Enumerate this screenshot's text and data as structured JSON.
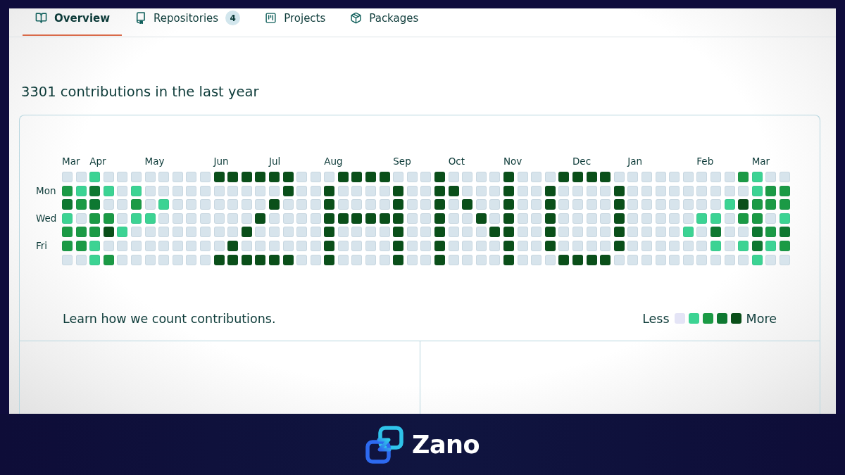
{
  "tabs": [
    {
      "kind": "overview",
      "label": "Overview",
      "selected": true
    },
    {
      "kind": "repositories",
      "label": "Repositories",
      "count": "4",
      "selected": false
    },
    {
      "kind": "projects",
      "label": "Projects",
      "selected": false
    },
    {
      "kind": "packages",
      "label": "Packages",
      "selected": false
    }
  ],
  "contributions": {
    "heading": "3301 contributions in the last year",
    "day_labels": [
      "Mon",
      "Wed",
      "Fri"
    ],
    "weeks": [
      {
        "month": "Mar",
        "days": [
          {
            "color": "#d7e4ec"
          },
          {
            "color": "#1b9a45"
          },
          {
            "color": "#0e7831"
          },
          {
            "color": "#3cd393"
          },
          {
            "color": "#1b9a45"
          },
          {
            "color": "#1b9a45"
          },
          {
            "color": "#d7e4ec"
          }
        ]
      },
      {
        "days": [
          {
            "color": "#d7e4ec"
          },
          {
            "color": "#3cd393"
          },
          {
            "color": "#1b9a45"
          },
          {
            "color": "#d7e4ec"
          },
          {
            "color": "#1b9a45"
          },
          {
            "color": "#1b9a45"
          },
          {
            "color": "#d7e4ec"
          }
        ]
      },
      {
        "month": "Apr",
        "days": [
          {
            "color": "#3cd393"
          },
          {
            "color": "#0e7831"
          },
          {
            "color": "#0e7831"
          },
          {
            "color": "#1b9a45"
          },
          {
            "color": "#1b9a45"
          },
          {
            "color": "#3cd393"
          },
          {
            "color": "#3cd393"
          }
        ]
      },
      {
        "days": [
          {
            "color": "#d7e4ec"
          },
          {
            "color": "#3cd393"
          },
          {
            "color": "#d7e4ec"
          },
          {
            "color": "#1b9a45"
          },
          {
            "color": "#0a4f19"
          },
          {
            "color": "#d7e4ec"
          },
          {
            "color": "#1b9a45"
          }
        ]
      },
      {
        "days": [
          {
            "color": "#d7e4ec"
          },
          {
            "color": "#d7e4ec"
          },
          {
            "color": "#d7e4ec"
          },
          {
            "color": "#d7e4ec"
          },
          {
            "color": "#3cd393"
          },
          {
            "color": "#d7e4ec"
          },
          {
            "color": "#d7e4ec"
          }
        ]
      },
      {
        "days": [
          {
            "color": "#d7e4ec"
          },
          {
            "color": "#3cd393"
          },
          {
            "color": "#1b9a45"
          },
          {
            "color": "#3cd393"
          },
          {
            "color": "#d7e4ec"
          },
          {
            "color": "#d7e4ec"
          },
          {
            "color": "#d7e4ec"
          }
        ]
      },
      {
        "month": "May",
        "days": [
          {
            "color": "#d7e4ec"
          },
          {
            "color": "#d7e4ec"
          },
          {
            "color": "#d7e4ec"
          },
          {
            "color": "#3cd393"
          },
          {
            "color": "#d7e4ec"
          },
          {
            "color": "#d7e4ec"
          },
          {
            "color": "#d7e4ec"
          }
        ]
      },
      {
        "days": [
          {
            "color": "#d7e4ec"
          },
          {
            "color": "#d7e4ec"
          },
          {
            "color": "#3cd393"
          },
          {
            "color": "#d7e4ec"
          },
          {
            "color": "#d7e4ec"
          },
          {
            "color": "#d7e4ec"
          },
          {
            "color": "#d7e4ec"
          }
        ]
      },
      {
        "days": [
          {
            "color": "#d7e4ec"
          },
          {
            "color": "#d7e4ec"
          },
          {
            "color": "#d7e4ec"
          },
          {
            "color": "#d7e4ec"
          },
          {
            "color": "#d7e4ec"
          },
          {
            "color": "#d7e4ec"
          },
          {
            "color": "#d7e4ec"
          }
        ]
      },
      {
        "days": [
          {
            "color": "#d7e4ec"
          },
          {
            "color": "#d7e4ec"
          },
          {
            "color": "#d7e4ec"
          },
          {
            "color": "#d7e4ec"
          },
          {
            "color": "#d7e4ec"
          },
          {
            "color": "#d7e4ec"
          },
          {
            "color": "#d7e4ec"
          }
        ]
      },
      {
        "days": [
          {
            "color": "#d7e4ec"
          },
          {
            "color": "#d7e4ec"
          },
          {
            "color": "#d7e4ec"
          },
          {
            "color": "#d7e4ec"
          },
          {
            "color": "#d7e4ec"
          },
          {
            "color": "#d7e4ec"
          },
          {
            "color": "#d7e4ec"
          }
        ]
      },
      {
        "month": "Jun",
        "days": [
          {
            "color": "#0a4f19"
          },
          {
            "color": "#d7e4ec"
          },
          {
            "color": "#d7e4ec"
          },
          {
            "color": "#d7e4ec"
          },
          {
            "color": "#d7e4ec"
          },
          {
            "color": "#d7e4ec"
          },
          {
            "color": "#0a4f19"
          }
        ]
      },
      {
        "days": [
          {
            "color": "#0a4f19"
          },
          {
            "color": "#d7e4ec"
          },
          {
            "color": "#d7e4ec"
          },
          {
            "color": "#d7e4ec"
          },
          {
            "color": "#d7e4ec"
          },
          {
            "color": "#0a4f19"
          },
          {
            "color": "#0a4f19"
          }
        ]
      },
      {
        "days": [
          {
            "color": "#0a4f19"
          },
          {
            "color": "#d7e4ec"
          },
          {
            "color": "#d7e4ec"
          },
          {
            "color": "#d7e4ec"
          },
          {
            "color": "#0a4f19"
          },
          {
            "color": "#d7e4ec"
          },
          {
            "color": "#0a4f19"
          }
        ]
      },
      {
        "days": [
          {
            "color": "#0a4f19"
          },
          {
            "color": "#d7e4ec"
          },
          {
            "color": "#d7e4ec"
          },
          {
            "color": "#0a4f19"
          },
          {
            "color": "#d7e4ec"
          },
          {
            "color": "#d7e4ec"
          },
          {
            "color": "#0a4f19"
          }
        ]
      },
      {
        "month": "Jul",
        "days": [
          {
            "color": "#0a4f19"
          },
          {
            "color": "#d7e4ec"
          },
          {
            "color": "#0a4f19"
          },
          {
            "color": "#d7e4ec"
          },
          {
            "color": "#d7e4ec"
          },
          {
            "color": "#d7e4ec"
          },
          {
            "color": "#0a4f19"
          }
        ]
      },
      {
        "days": [
          {
            "color": "#0a4f19"
          },
          {
            "color": "#0a4f19"
          },
          {
            "color": "#d7e4ec"
          },
          {
            "color": "#d7e4ec"
          },
          {
            "color": "#d7e4ec"
          },
          {
            "color": "#d7e4ec"
          },
          {
            "color": "#0a4f19"
          }
        ]
      },
      {
        "days": [
          {
            "color": "#d7e4ec"
          },
          {
            "color": "#d7e4ec"
          },
          {
            "color": "#d7e4ec"
          },
          {
            "color": "#d7e4ec"
          },
          {
            "color": "#d7e4ec"
          },
          {
            "color": "#d7e4ec"
          },
          {
            "color": "#d7e4ec"
          }
        ]
      },
      {
        "days": [
          {
            "color": "#d7e4ec"
          },
          {
            "color": "#d7e4ec"
          },
          {
            "color": "#d7e4ec"
          },
          {
            "color": "#d7e4ec"
          },
          {
            "color": "#d7e4ec"
          },
          {
            "color": "#d7e4ec"
          },
          {
            "color": "#d7e4ec"
          }
        ]
      },
      {
        "month": "Aug",
        "days": [
          {
            "color": "#d7e4ec"
          },
          {
            "color": "#0a4f19"
          },
          {
            "color": "#0a4f19"
          },
          {
            "color": "#0a4f19"
          },
          {
            "color": "#0a4f19"
          },
          {
            "color": "#0a4f19"
          },
          {
            "color": "#0a4f19"
          }
        ]
      },
      {
        "days": [
          {
            "color": "#0a4f19"
          },
          {
            "color": "#d7e4ec"
          },
          {
            "color": "#d7e4ec"
          },
          {
            "color": "#0a4f19"
          },
          {
            "color": "#d7e4ec"
          },
          {
            "color": "#d7e4ec"
          },
          {
            "color": "#d7e4ec"
          }
        ]
      },
      {
        "days": [
          {
            "color": "#0a4f19"
          },
          {
            "color": "#d7e4ec"
          },
          {
            "color": "#d7e4ec"
          },
          {
            "color": "#0a4f19"
          },
          {
            "color": "#d7e4ec"
          },
          {
            "color": "#d7e4ec"
          },
          {
            "color": "#d7e4ec"
          }
        ]
      },
      {
        "days": [
          {
            "color": "#0a4f19"
          },
          {
            "color": "#d7e4ec"
          },
          {
            "color": "#d7e4ec"
          },
          {
            "color": "#0a4f19"
          },
          {
            "color": "#d7e4ec"
          },
          {
            "color": "#d7e4ec"
          },
          {
            "color": "#d7e4ec"
          }
        ]
      },
      {
        "days": [
          {
            "color": "#0a4f19"
          },
          {
            "color": "#d7e4ec"
          },
          {
            "color": "#d7e4ec"
          },
          {
            "color": "#0a4f19"
          },
          {
            "color": "#d7e4ec"
          },
          {
            "color": "#d7e4ec"
          },
          {
            "color": "#d7e4ec"
          }
        ]
      },
      {
        "month": "Sep",
        "days": [
          {
            "color": "#d7e4ec"
          },
          {
            "color": "#0a4f19"
          },
          {
            "color": "#0a4f19"
          },
          {
            "color": "#0a4f19"
          },
          {
            "color": "#0a4f19"
          },
          {
            "color": "#0a4f19"
          },
          {
            "color": "#0a4f19"
          }
        ]
      },
      {
        "days": [
          {
            "color": "#d7e4ec"
          },
          {
            "color": "#d7e4ec"
          },
          {
            "color": "#d7e4ec"
          },
          {
            "color": "#d7e4ec"
          },
          {
            "color": "#d7e4ec"
          },
          {
            "color": "#d7e4ec"
          },
          {
            "color": "#d7e4ec"
          }
        ]
      },
      {
        "days": [
          {
            "color": "#d7e4ec"
          },
          {
            "color": "#d7e4ec"
          },
          {
            "color": "#d7e4ec"
          },
          {
            "color": "#d7e4ec"
          },
          {
            "color": "#d7e4ec"
          },
          {
            "color": "#d7e4ec"
          },
          {
            "color": "#d7e4ec"
          }
        ]
      },
      {
        "days": [
          {
            "color": "#0a4f19"
          },
          {
            "color": "#0a4f19"
          },
          {
            "color": "#0a4f19"
          },
          {
            "color": "#0a4f19"
          },
          {
            "color": "#0a4f19"
          },
          {
            "color": "#0a4f19"
          },
          {
            "color": "#0a4f19"
          }
        ]
      },
      {
        "month": "Oct",
        "days": [
          {
            "color": "#d7e4ec"
          },
          {
            "color": "#0a4f19"
          },
          {
            "color": "#d7e4ec"
          },
          {
            "color": "#d7e4ec"
          },
          {
            "color": "#d7e4ec"
          },
          {
            "color": "#d7e4ec"
          },
          {
            "color": "#d7e4ec"
          }
        ]
      },
      {
        "days": [
          {
            "color": "#d7e4ec"
          },
          {
            "color": "#d7e4ec"
          },
          {
            "color": "#0a4f19"
          },
          {
            "color": "#d7e4ec"
          },
          {
            "color": "#d7e4ec"
          },
          {
            "color": "#d7e4ec"
          },
          {
            "color": "#d7e4ec"
          }
        ]
      },
      {
        "days": [
          {
            "color": "#d7e4ec"
          },
          {
            "color": "#d7e4ec"
          },
          {
            "color": "#d7e4ec"
          },
          {
            "color": "#0a4f19"
          },
          {
            "color": "#d7e4ec"
          },
          {
            "color": "#d7e4ec"
          },
          {
            "color": "#d7e4ec"
          }
        ]
      },
      {
        "days": [
          {
            "color": "#d7e4ec"
          },
          {
            "color": "#d7e4ec"
          },
          {
            "color": "#d7e4ec"
          },
          {
            "color": "#d7e4ec"
          },
          {
            "color": "#0a4f19"
          },
          {
            "color": "#d7e4ec"
          },
          {
            "color": "#d7e4ec"
          }
        ]
      },
      {
        "month": "Nov",
        "days": [
          {
            "color": "#0a4f19"
          },
          {
            "color": "#0a4f19"
          },
          {
            "color": "#0a4f19"
          },
          {
            "color": "#0a4f19"
          },
          {
            "color": "#0a4f19"
          },
          {
            "color": "#0a4f19"
          },
          {
            "color": "#0a4f19"
          }
        ]
      },
      {
        "days": [
          {
            "color": "#d7e4ec"
          },
          {
            "color": "#d7e4ec"
          },
          {
            "color": "#d7e4ec"
          },
          {
            "color": "#d7e4ec"
          },
          {
            "color": "#d7e4ec"
          },
          {
            "color": "#d7e4ec"
          },
          {
            "color": "#d7e4ec"
          }
        ]
      },
      {
        "days": [
          {
            "color": "#d7e4ec"
          },
          {
            "color": "#d7e4ec"
          },
          {
            "color": "#d7e4ec"
          },
          {
            "color": "#d7e4ec"
          },
          {
            "color": "#d7e4ec"
          },
          {
            "color": "#d7e4ec"
          },
          {
            "color": "#d7e4ec"
          }
        ]
      },
      {
        "days": [
          {
            "color": "#d7e4ec"
          },
          {
            "color": "#0a4f19"
          },
          {
            "color": "#0a4f19"
          },
          {
            "color": "#0a4f19"
          },
          {
            "color": "#0a4f19"
          },
          {
            "color": "#0a4f19"
          },
          {
            "color": "#d7e4ec"
          }
        ]
      },
      {
        "days": [
          {
            "color": "#0a4f19"
          },
          {
            "color": "#d7e4ec"
          },
          {
            "color": "#d7e4ec"
          },
          {
            "color": "#d7e4ec"
          },
          {
            "color": "#d7e4ec"
          },
          {
            "color": "#d7e4ec"
          },
          {
            "color": "#0a4f19"
          }
        ]
      },
      {
        "month": "Dec",
        "days": [
          {
            "color": "#0a4f19"
          },
          {
            "color": "#d7e4ec"
          },
          {
            "color": "#d7e4ec"
          },
          {
            "color": "#d7e4ec"
          },
          {
            "color": "#d7e4ec"
          },
          {
            "color": "#d7e4ec"
          },
          {
            "color": "#0a4f19"
          }
        ]
      },
      {
        "days": [
          {
            "color": "#0a4f19"
          },
          {
            "color": "#d7e4ec"
          },
          {
            "color": "#d7e4ec"
          },
          {
            "color": "#d7e4ec"
          },
          {
            "color": "#d7e4ec"
          },
          {
            "color": "#d7e4ec"
          },
          {
            "color": "#0a4f19"
          }
        ]
      },
      {
        "days": [
          {
            "color": "#0a4f19"
          },
          {
            "color": "#d7e4ec"
          },
          {
            "color": "#d7e4ec"
          },
          {
            "color": "#d7e4ec"
          },
          {
            "color": "#d7e4ec"
          },
          {
            "color": "#d7e4ec"
          },
          {
            "color": "#0a4f19"
          }
        ]
      },
      {
        "days": [
          {
            "color": "#d7e4ec"
          },
          {
            "color": "#0a4f19"
          },
          {
            "color": "#0a4f19"
          },
          {
            "color": "#0a4f19"
          },
          {
            "color": "#0a4f19"
          },
          {
            "color": "#0a4f19"
          },
          {
            "color": "#d7e4ec"
          }
        ]
      },
      {
        "month": "Jan",
        "days": [
          {
            "color": "#d7e4ec"
          },
          {
            "color": "#d7e4ec"
          },
          {
            "color": "#d7e4ec"
          },
          {
            "color": "#d7e4ec"
          },
          {
            "color": "#d7e4ec"
          },
          {
            "color": "#d7e4ec"
          },
          {
            "color": "#d7e4ec"
          }
        ]
      },
      {
        "days": [
          {
            "color": "#d7e4ec"
          },
          {
            "color": "#d7e4ec"
          },
          {
            "color": "#d7e4ec"
          },
          {
            "color": "#d7e4ec"
          },
          {
            "color": "#d7e4ec"
          },
          {
            "color": "#d7e4ec"
          },
          {
            "color": "#d7e4ec"
          }
        ]
      },
      {
        "days": [
          {
            "color": "#d7e4ec"
          },
          {
            "color": "#d7e4ec"
          },
          {
            "color": "#d7e4ec"
          },
          {
            "color": "#d7e4ec"
          },
          {
            "color": "#d7e4ec"
          },
          {
            "color": "#d7e4ec"
          },
          {
            "color": "#d7e4ec"
          }
        ]
      },
      {
        "days": [
          {
            "color": "#d7e4ec"
          },
          {
            "color": "#d7e4ec"
          },
          {
            "color": "#d7e4ec"
          },
          {
            "color": "#d7e4ec"
          },
          {
            "color": "#d7e4ec"
          },
          {
            "color": "#d7e4ec"
          },
          {
            "color": "#d7e4ec"
          }
        ]
      },
      {
        "days": [
          {
            "color": "#d7e4ec"
          },
          {
            "color": "#d7e4ec"
          },
          {
            "color": "#d7e4ec"
          },
          {
            "color": "#d7e4ec"
          },
          {
            "color": "#3cd393"
          },
          {
            "color": "#d7e4ec"
          },
          {
            "color": "#d7e4ec"
          }
        ]
      },
      {
        "month": "Feb",
        "days": [
          {
            "color": "#d7e4ec"
          },
          {
            "color": "#d7e4ec"
          },
          {
            "color": "#d7e4ec"
          },
          {
            "color": "#3cd393"
          },
          {
            "color": "#d7e4ec"
          },
          {
            "color": "#d7e4ec"
          },
          {
            "color": "#d7e4ec"
          }
        ]
      },
      {
        "days": [
          {
            "color": "#d7e4ec"
          },
          {
            "color": "#d7e4ec"
          },
          {
            "color": "#d7e4ec"
          },
          {
            "color": "#3cd393"
          },
          {
            "color": "#0e7831"
          },
          {
            "color": "#3cd393"
          },
          {
            "color": "#d7e4ec"
          }
        ]
      },
      {
        "days": [
          {
            "color": "#d7e4ec"
          },
          {
            "color": "#d7e4ec"
          },
          {
            "color": "#3cd393"
          },
          {
            "color": "#d7e4ec"
          },
          {
            "color": "#d7e4ec"
          },
          {
            "color": "#d7e4ec"
          },
          {
            "color": "#d7e4ec"
          }
        ]
      },
      {
        "days": [
          {
            "color": "#1b9a45"
          },
          {
            "color": "#d7e4ec"
          },
          {
            "color": "#0a4f19"
          },
          {
            "color": "#1b9a45"
          },
          {
            "color": "#d7e4ec"
          },
          {
            "color": "#3cd393"
          },
          {
            "color": "#d7e4ec"
          }
        ]
      },
      {
        "month": "Mar",
        "days": [
          {
            "color": "#3cd393"
          },
          {
            "color": "#3cd393"
          },
          {
            "color": "#1b9a45"
          },
          {
            "color": "#1b9a45"
          },
          {
            "color": "#0e7831"
          },
          {
            "color": "#0e7831"
          },
          {
            "color": "#3cd393"
          }
        ]
      },
      {
        "days": [
          {
            "color": "#d7e4ec"
          },
          {
            "color": "#1b9a45"
          },
          {
            "color": "#1b9a45"
          },
          {
            "color": "#d7e4ec"
          },
          {
            "color": "#1b9a45"
          },
          {
            "color": "#3cd393"
          },
          {
            "color": "#d7e4ec"
          }
        ]
      },
      {
        "days": [
          {
            "color": "#d7e4ec"
          },
          {
            "color": "#1b9a45"
          },
          {
            "color": "#1b9a45"
          },
          {
            "color": "#3cd393"
          },
          {
            "color": "#0e7831"
          },
          {
            "color": "#1b9a45"
          },
          {
            "color": "#d7e4ec"
          }
        ]
      }
    ],
    "learn_link": "Learn how we count contributions.",
    "legend": {
      "less": "Less",
      "more": "More",
      "swatches": [
        {
          "color": "#e4e4f6"
        },
        {
          "color": "#3cd393"
        },
        {
          "color": "#1b9a45"
        },
        {
          "color": "#0e7831"
        },
        {
          "color": "#0a4f19"
        }
      ]
    }
  },
  "brand": {
    "name": "Zano"
  }
}
